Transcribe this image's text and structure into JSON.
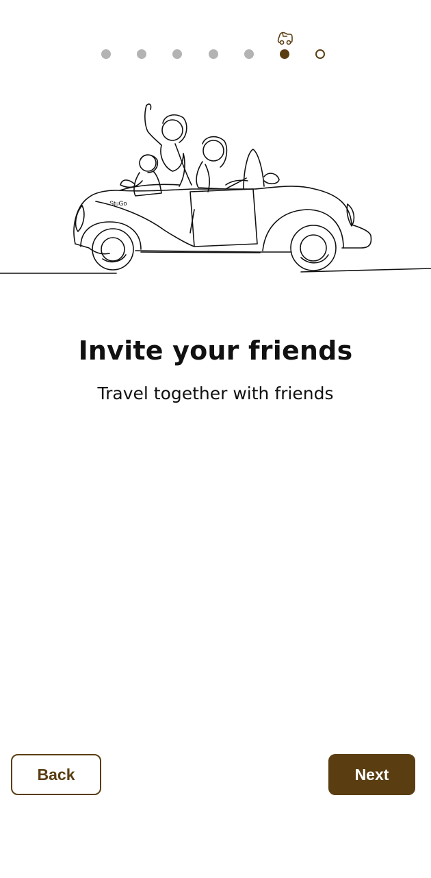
{
  "progress": {
    "total_steps": 7,
    "current_step": 6,
    "marker_icon": "car-icon"
  },
  "illustration": {
    "subject": "friends-in-convertible-car",
    "car_text": "StuGo"
  },
  "content": {
    "title": "Invite your friends",
    "subtitle": "Travel together with friends"
  },
  "buttons": {
    "back_label": "Back",
    "next_label": "Next"
  },
  "colors": {
    "accent": "#5a3e12",
    "inactive_dot": "#b3b3b3",
    "text": "#111111",
    "background": "#ffffff"
  }
}
